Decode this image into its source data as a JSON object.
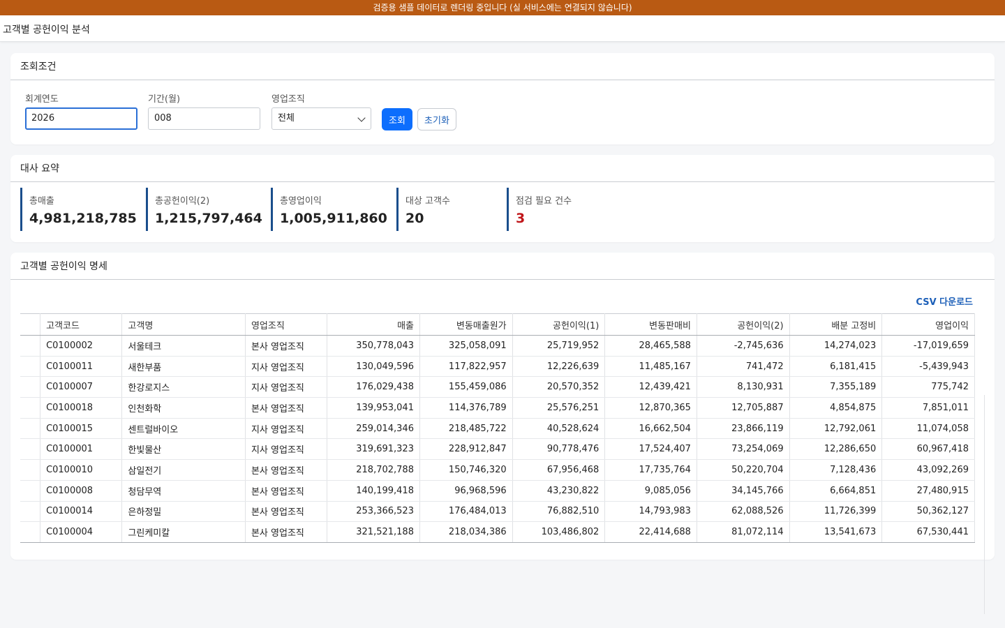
{
  "banner": "검증용 샘플 데이터로 렌더링 중입니다 (실 서비스에는 연결되지 않습니다)",
  "page_title": "고객별 공헌이익 분석",
  "search": {
    "title": "조회조건",
    "fiscal_year_label": "회계연도",
    "fiscal_year_value": "2026",
    "period_label": "기간(월)",
    "period_value": "008",
    "org_label": "영업조직",
    "org_value": "전체",
    "search_button": "조회",
    "reset_button": "초기화"
  },
  "summary": {
    "title": "대사 요약",
    "kpis": [
      {
        "label": "총매출",
        "value": "4,981,218,785"
      },
      {
        "label": "총공헌이익(2)",
        "value": "1,215,797,464"
      },
      {
        "label": "총영업이익",
        "value": "1,005,911,860"
      },
      {
        "label": "대상 고객수",
        "value": "20"
      },
      {
        "label": "점검 필요 건수",
        "value": "3"
      }
    ]
  },
  "detail": {
    "title": "고객별 공헌이익 명세",
    "csv_label": "CSV 다운로드",
    "columns": [
      "고객코드",
      "고객명",
      "영업조직",
      "매출",
      "변동매출원가",
      "공헌이익(1)",
      "변동판매비",
      "공헌이익(2)",
      "배분 고정비",
      "영업이익"
    ],
    "rows": [
      [
        "C0100002",
        "서울테크",
        "본사 영업조직",
        "350,778,043",
        "325,058,091",
        "25,719,952",
        "28,465,588",
        "-2,745,636",
        "14,274,023",
        "-17,019,659"
      ],
      [
        "C0100011",
        "새한부품",
        "지사 영업조직",
        "130,049,596",
        "117,822,957",
        "12,226,639",
        "11,485,167",
        "741,472",
        "6,181,415",
        "-5,439,943"
      ],
      [
        "C0100007",
        "한강로지스",
        "지사 영업조직",
        "176,029,438",
        "155,459,086",
        "20,570,352",
        "12,439,421",
        "8,130,931",
        "7,355,189",
        "775,742"
      ],
      [
        "C0100018",
        "인천화학",
        "본사 영업조직",
        "139,953,041",
        "114,376,789",
        "25,576,251",
        "12,870,365",
        "12,705,887",
        "4,854,875",
        "7,851,011"
      ],
      [
        "C0100015",
        "센트럴바이오",
        "지사 영업조직",
        "259,014,346",
        "218,485,722",
        "40,528,624",
        "16,662,504",
        "23,866,119",
        "12,792,061",
        "11,074,058"
      ],
      [
        "C0100001",
        "한빛물산",
        "지사 영업조직",
        "319,691,323",
        "228,912,847",
        "90,778,476",
        "17,524,407",
        "73,254,069",
        "12,286,650",
        "60,967,418"
      ],
      [
        "C0100010",
        "삼일전기",
        "본사 영업조직",
        "218,702,788",
        "150,746,320",
        "67,956,468",
        "17,735,764",
        "50,220,704",
        "7,128,436",
        "43,092,269"
      ],
      [
        "C0100008",
        "청담무역",
        "본사 영업조직",
        "140,199,418",
        "96,968,596",
        "43,230,822",
        "9,085,056",
        "34,145,766",
        "6,664,851",
        "27,480,915"
      ],
      [
        "C0100014",
        "은하정밀",
        "본사 영업조직",
        "253,366,523",
        "176,484,013",
        "76,882,510",
        "14,793,983",
        "62,088,526",
        "11,726,399",
        "50,362,127"
      ],
      [
        "C0100004",
        "그린케미칼",
        "본사 영업조직",
        "321,521,188",
        "218,034,386",
        "103,486,802",
        "22,414,688",
        "81,072,114",
        "13,541,673",
        "67,530,441"
      ]
    ]
  },
  "colors": {
    "banner": "#b95a13",
    "primary": "#0d6efd",
    "kpi_border": "#1a4e8c",
    "warn": "#c0161a"
  }
}
